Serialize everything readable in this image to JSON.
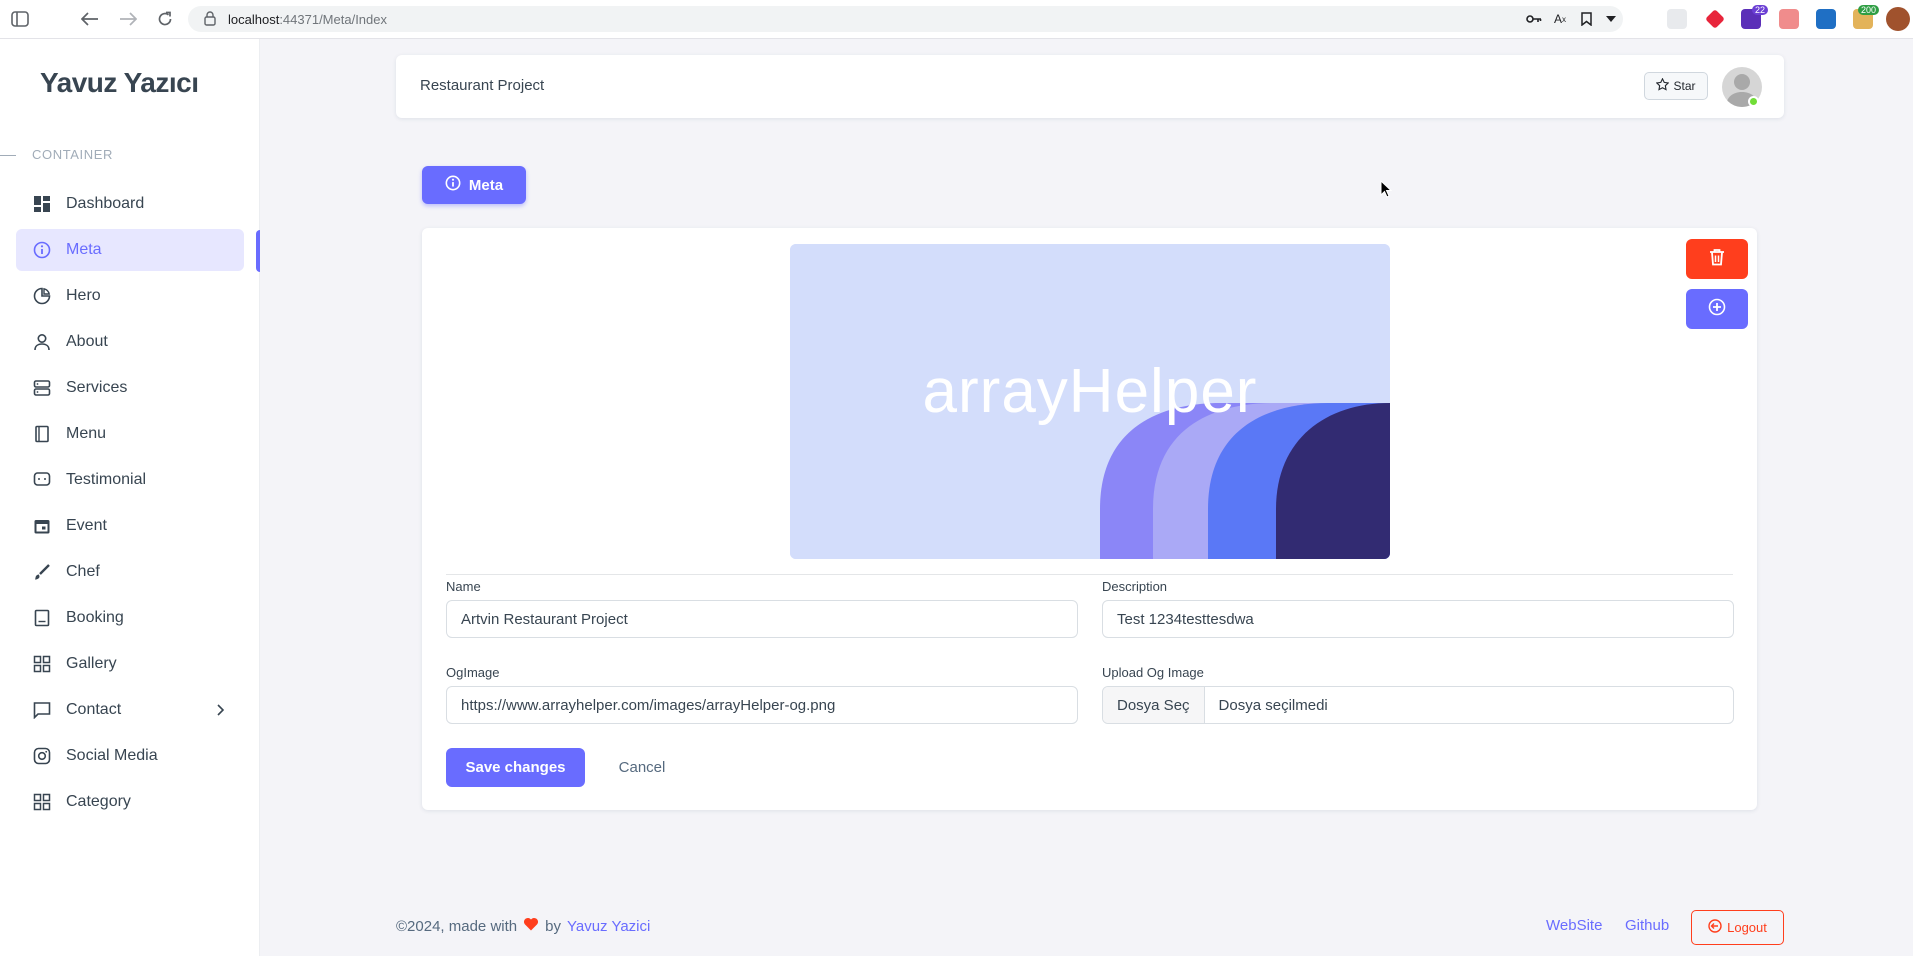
{
  "browser": {
    "url_host": "localhost",
    "url_path": ":44371/Meta/Index",
    "badge_22": "22",
    "badge_200": "200"
  },
  "sidebar": {
    "brand": "Yavuz Yazıcı",
    "section": "CONTAINER",
    "items": [
      {
        "label": "Dashboard",
        "icon": "dashboard-icon"
      },
      {
        "label": "Meta",
        "icon": "info-icon",
        "active": true
      },
      {
        "label": "Hero",
        "icon": "pie-chart-icon"
      },
      {
        "label": "About",
        "icon": "user-icon"
      },
      {
        "label": "Services",
        "icon": "server-icon"
      },
      {
        "label": "Menu",
        "icon": "book-icon"
      },
      {
        "label": "Testimonial",
        "icon": "chat-icon"
      },
      {
        "label": "Event",
        "icon": "calendar-icon"
      },
      {
        "label": "Chef",
        "icon": "brush-icon"
      },
      {
        "label": "Booking",
        "icon": "notebook-icon"
      },
      {
        "label": "Gallery",
        "icon": "grid-icon"
      },
      {
        "label": "Contact",
        "icon": "message-icon",
        "has_submenu": true
      },
      {
        "label": "Social Media",
        "icon": "instagram-icon"
      },
      {
        "label": "Category",
        "icon": "grid-icon"
      }
    ]
  },
  "navbar": {
    "title": "Restaurant Project",
    "star_label": "Star"
  },
  "page": {
    "meta_button": "Meta",
    "og_image_text": "arrayHelper"
  },
  "form": {
    "name_label": "Name",
    "name_value": "Artvin Restaurant Project",
    "description_label": "Description",
    "description_value": "Test 1234testtesdwa",
    "ogimage_label": "OgImage",
    "ogimage_value": "https://www.arrayhelper.com/images/arrayHelper-og.png",
    "upload_label": "Upload Og Image",
    "upload_button": "Dosya Seç",
    "upload_status": "Dosya seçilmedi",
    "save_label": "Save changes",
    "cancel_label": "Cancel"
  },
  "footer": {
    "copyright": "©2024, made with",
    "by": "by",
    "author": "Yavuz Yazici",
    "website": "WebSite",
    "github": "Github",
    "logout": "Logout"
  },
  "colors": {
    "primary": "#696cff",
    "danger": "#ff3e1d",
    "active_bg": "#e7e7ff"
  }
}
